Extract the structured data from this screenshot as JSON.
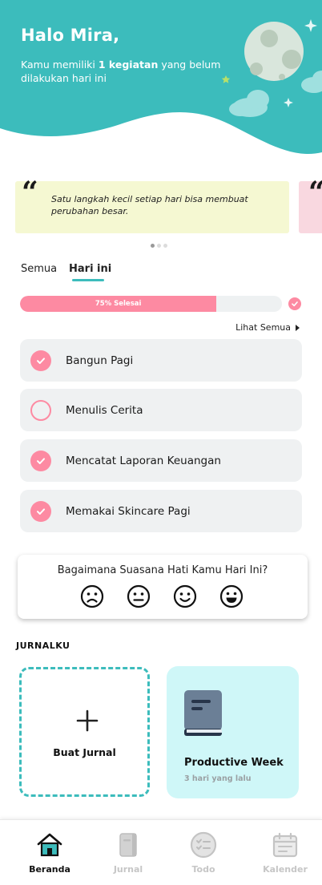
{
  "header": {
    "greeting": "Halo Mira,",
    "subtitle_prefix": "Kamu memiliki ",
    "subtitle_bold": "1 kegiatan",
    "subtitle_suffix": " yang belum dilakukan hari ini"
  },
  "quotes": [
    {
      "mark": "“",
      "text": "Satu langkah kecil setiap hari bisa membuat perubahan besar."
    },
    {
      "mark": "“",
      "text": ""
    }
  ],
  "tabs": [
    {
      "label": "Semua",
      "active": false
    },
    {
      "label": "Hari ini",
      "active": true
    }
  ],
  "progress": {
    "label": "75% Selesai",
    "fraction": 0.75
  },
  "see_all_label": "Lihat Semua",
  "tasks": [
    {
      "label": "Bangun Pagi",
      "done": true
    },
    {
      "label": "Menulis Cerita",
      "done": false
    },
    {
      "label": "Mencatat Laporan Keuangan",
      "done": true
    },
    {
      "label": "Memakai Skincare Pagi",
      "done": true
    }
  ],
  "mood": {
    "question": "Bagaimana Suasana Hati Kamu Hari Ini?",
    "options": [
      "sad-face-icon",
      "neutral-face-icon",
      "smile-face-icon",
      "grin-face-icon"
    ]
  },
  "journal": {
    "section_title": "JURNALKU",
    "new_label": "Buat Jurnal",
    "entries": [
      {
        "title": "Productive Week",
        "date": "3 hari yang lalu"
      }
    ]
  },
  "nav": [
    {
      "label": "Beranda",
      "icon": "home-icon",
      "active": true
    },
    {
      "label": "Jurnal",
      "icon": "journal-icon",
      "active": false
    },
    {
      "label": "Todo",
      "icon": "todo-icon",
      "active": false
    },
    {
      "label": "Kalender",
      "icon": "calendar-icon",
      "active": false
    }
  ],
  "colors": {
    "header_teal": "#3cbcbc",
    "accent_pink": "#fd8aa2",
    "quote_yellow": "#f5f8d2",
    "quote_pink": "#f9d8e0",
    "task_bg": "#eff1f2",
    "journal_card_bg": "#cff7f8"
  }
}
